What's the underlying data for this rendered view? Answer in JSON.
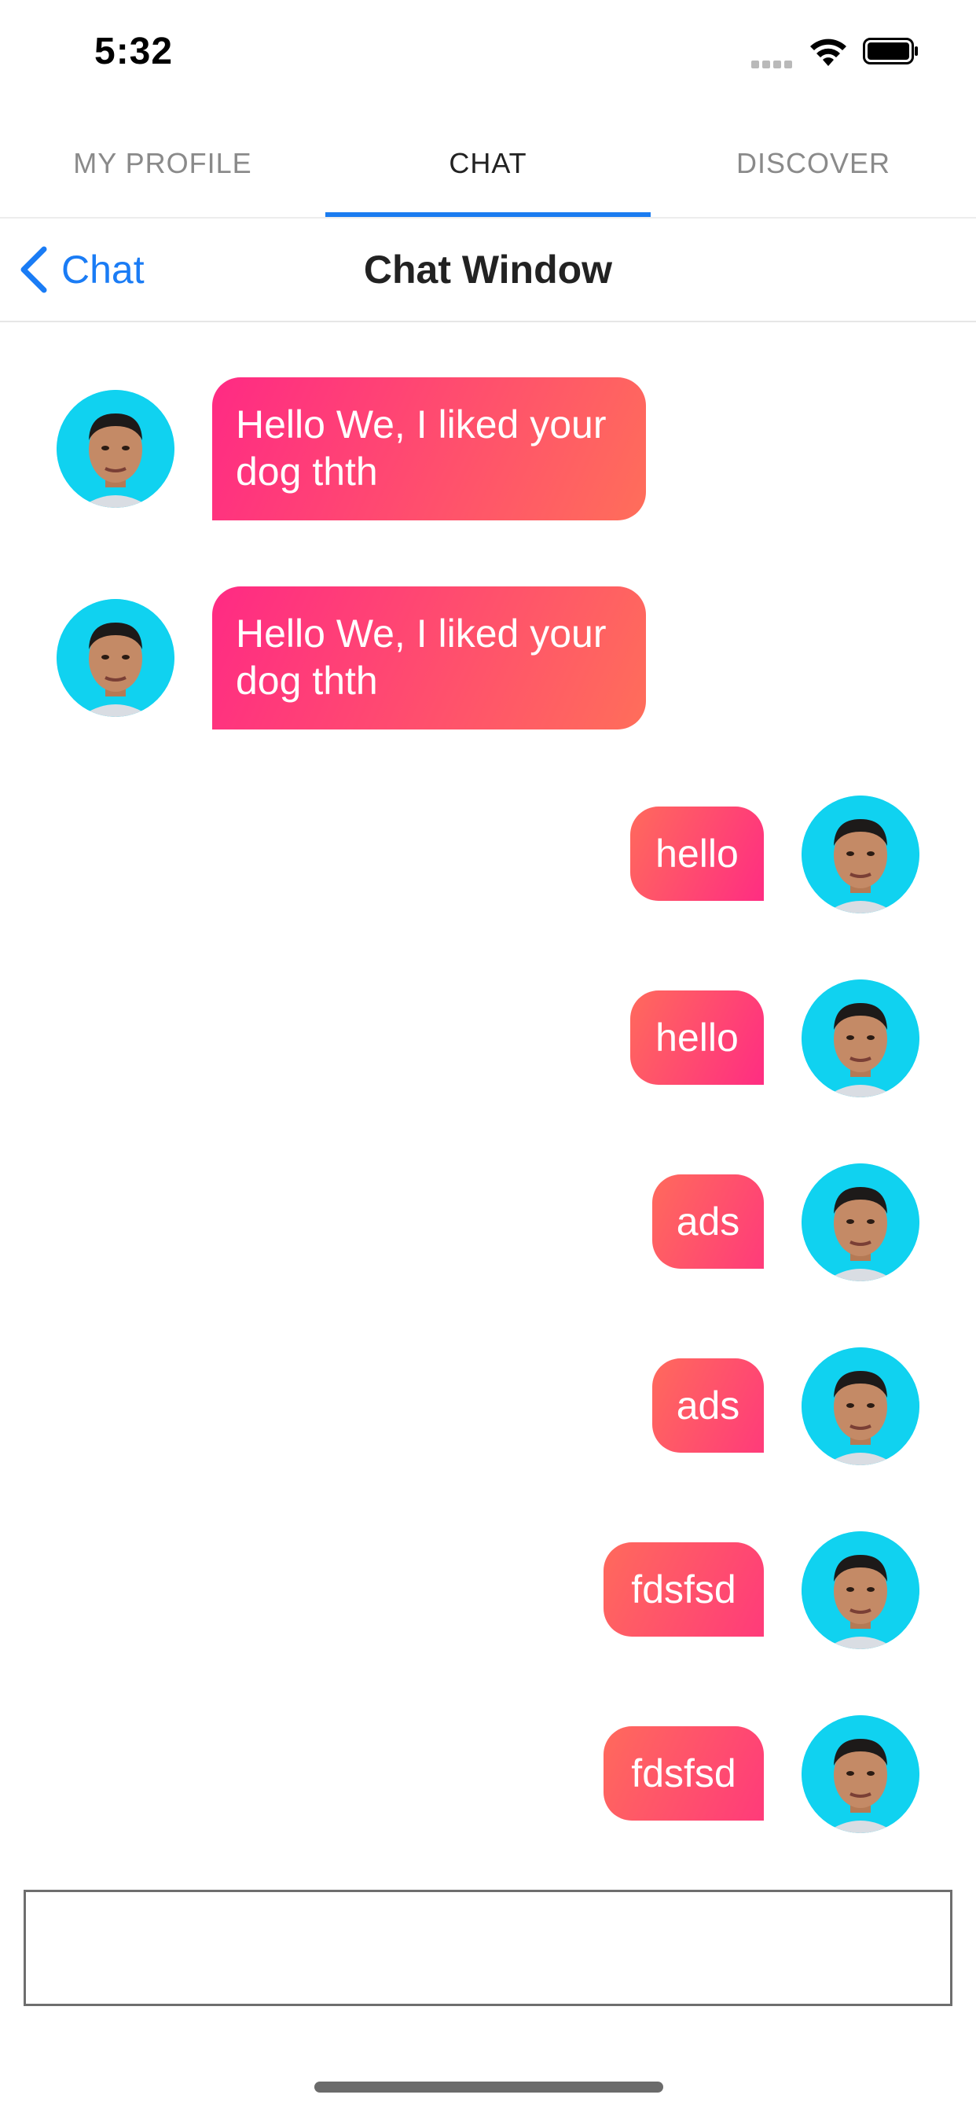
{
  "status_bar": {
    "time": "5:32"
  },
  "tabs": [
    {
      "label": "MY PROFILE",
      "active": false
    },
    {
      "label": "CHAT",
      "active": true
    },
    {
      "label": "DISCOVER",
      "active": false
    }
  ],
  "nav": {
    "back_label": "Chat",
    "title": "Chat Window"
  },
  "messages": [
    {
      "direction": "incoming",
      "text": "Hello We, I liked your dog thth",
      "lines": [
        "Hello We, I liked your",
        "dog thth"
      ]
    },
    {
      "direction": "incoming",
      "text": "Hello We, I liked your dog thth",
      "lines": [
        "Hello We, I liked your",
        "dog thth"
      ]
    },
    {
      "direction": "outgoing",
      "text": "hello"
    },
    {
      "direction": "outgoing",
      "text": "hello"
    },
    {
      "direction": "outgoing",
      "text": "ads"
    },
    {
      "direction": "outgoing",
      "text": "ads"
    },
    {
      "direction": "outgoing",
      "text": "fdsfsd"
    },
    {
      "direction": "outgoing",
      "text": "fdsfsd"
    }
  ],
  "input": {
    "value": "",
    "placeholder": ""
  },
  "colors": {
    "accent_blue": "#1b7cf0",
    "bubble_pink": "#ff2a84",
    "bubble_orange": "#ff6e5a",
    "avatar_background": "#10d2f0"
  },
  "icons": {
    "back": "chevron-left-icon",
    "wifi": "wifi-icon",
    "battery": "battery-icon",
    "signal": "signal-icon"
  }
}
